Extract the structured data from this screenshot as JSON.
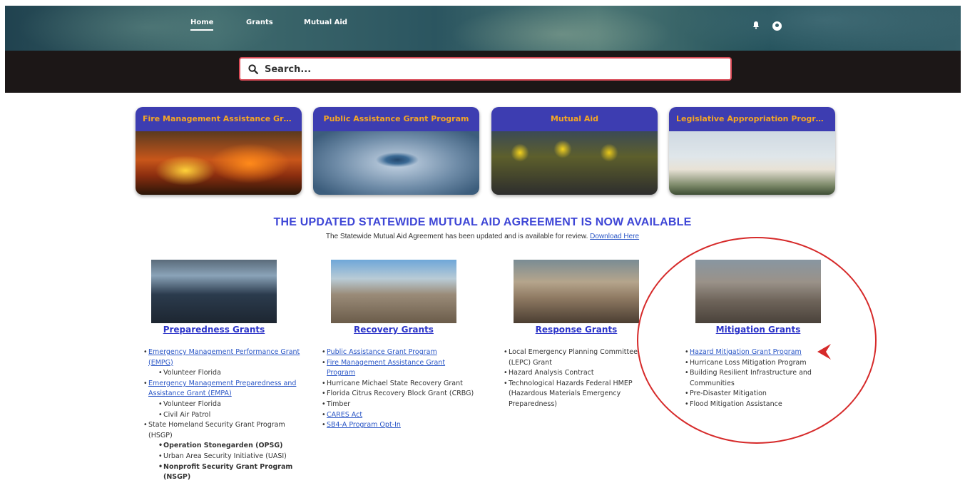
{
  "nav": {
    "items": [
      "Home",
      "Grants",
      "Mutual Aid"
    ],
    "active": "Home"
  },
  "search": {
    "placeholder": "Search..."
  },
  "cards": [
    {
      "title": "Fire Management Assistance Gra..."
    },
    {
      "title": "Public Assistance Grant Program"
    },
    {
      "title": "Mutual Aid"
    },
    {
      "title": "Legislative Appropriation Program"
    }
  ],
  "announcement": {
    "heading": "THE UPDATED STATEWIDE MUTUAL AID AGREEMENT IS NOW AVAILABLE",
    "text": "The Statewide Mutual Aid Agreement has been updated and is available for review.",
    "link": "Download Here"
  },
  "preparedness": {
    "title": "Preparedness Grants",
    "items": {
      "empg": "Emergency Management Performance Grant (EMPG)",
      "vol1": "Volunteer Florida",
      "empa": "Emergency Management Preparedness and Assistance Grant (EMPA)",
      "vol2": "Volunteer Florida",
      "cap": "Civil Air Patrol",
      "hsgp": "State Homeland Security Grant Program (HSGP)",
      "opsg": "Operation Stonegarden (OPSG)",
      "uasi": "Urban Area Security Initiative (UASI)",
      "nsgp": "Nonprofit Security Grant Program (NSGP)"
    }
  },
  "recovery": {
    "title": "Recovery Grants",
    "items": {
      "pagp": "Public Assistance Grant Program",
      "fmag": "Fire Management Assistance Grant Program",
      "hmsrg": "Hurricane Michael State Recovery Grant",
      "crbg": "Florida Citrus Recovery Block Grant (CRBG)",
      "timber": "Timber",
      "cares": "CARES Act",
      "sb4a": "SB4-A Program Opt-In"
    }
  },
  "response": {
    "title": "Response Grants",
    "items": {
      "lepc": "Local Emergency Planning Committee (LEPC) Grant",
      "hac": "Hazard Analysis Contract",
      "hmep": "Technological Hazards Federal HMEP (Hazardous Materials Emergency Preparedness)"
    }
  },
  "mitigation": {
    "title": "Mitigation Grants",
    "items": {
      "hmgp": "Hazard Mitigation Grant Program",
      "hlmp": "Hurricane Loss Mitigation Program",
      "bric": "Building Resilient Infrastructure and Communities",
      "pdm": "Pre-Disaster Mitigation",
      "fma": "Flood Mitigation Assistance"
    }
  },
  "colors": {
    "header_band": "#1c1717",
    "card_header": "#3d3db1",
    "card_title": "#f5a623",
    "heading_blue": "#3e46d6",
    "annotation_red": "#d62a2a"
  },
  "icons": [
    "search-icon",
    "bell-icon",
    "user-avatar-icon",
    "arrow-pointer-icon"
  ]
}
